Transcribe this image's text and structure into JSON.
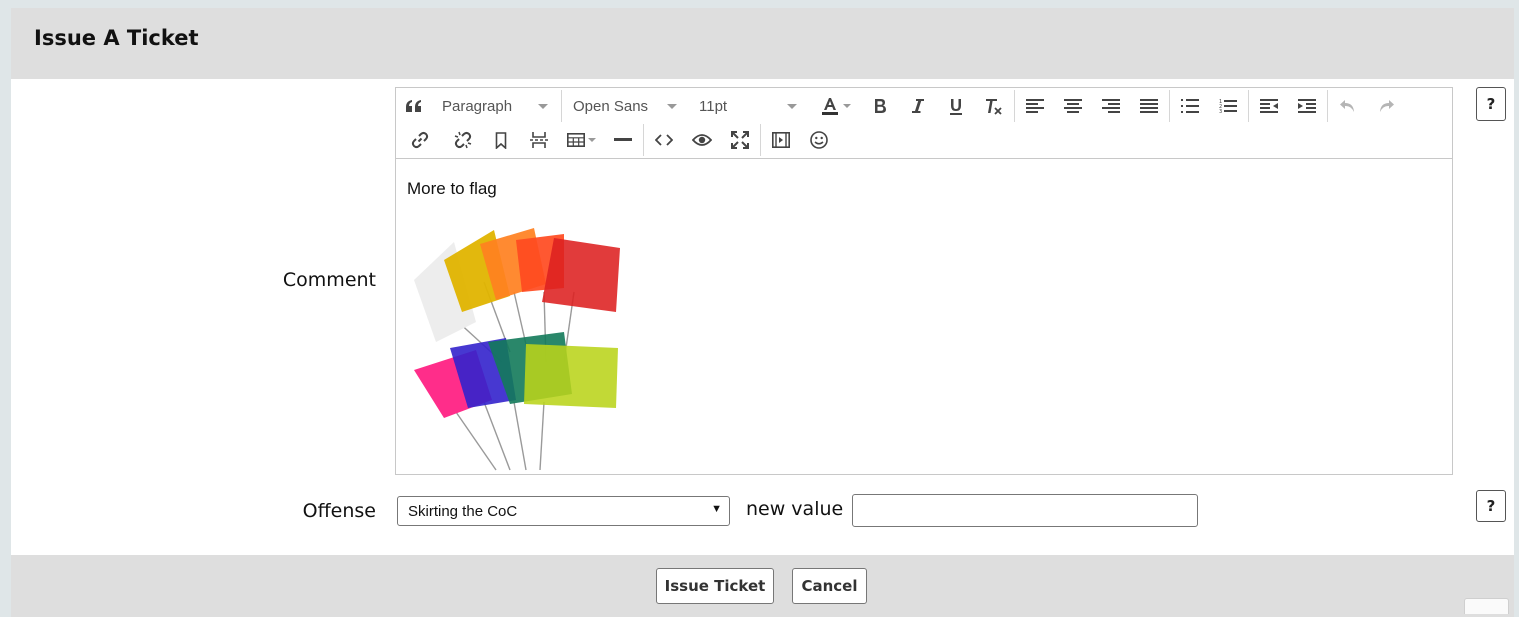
{
  "dialog": {
    "title": "Issue A Ticket"
  },
  "form": {
    "comment_label": "Comment",
    "offense_label": "Offense",
    "help_label": "?",
    "offense_selected": "Skirting the CoC",
    "new_value_label": "new value",
    "new_value_value": ""
  },
  "editor": {
    "block_format": "Paragraph",
    "font_family": "Open Sans",
    "font_size": "11pt",
    "content_text": "More to flag",
    "toolbar_icons": [
      "blockquote-icon",
      "text-color-icon",
      "bold-icon",
      "italic-icon",
      "underline-icon",
      "clear-formatting-icon",
      "align-left-icon",
      "align-center-icon",
      "align-right-icon",
      "align-justify-icon",
      "bullet-list-icon",
      "numbered-list-icon",
      "outdent-icon",
      "indent-icon",
      "undo-icon",
      "redo-icon",
      "link-icon",
      "unlink-icon",
      "bookmark-icon",
      "page-break-icon",
      "table-icon",
      "horizontal-rule-icon",
      "source-code-icon",
      "preview-icon",
      "fullscreen-icon",
      "media-icon",
      "emoticon-icon"
    ],
    "accent_text_color": "#222222"
  },
  "footer": {
    "issue_label": "Issue Ticket",
    "cancel_label": "Cancel"
  }
}
